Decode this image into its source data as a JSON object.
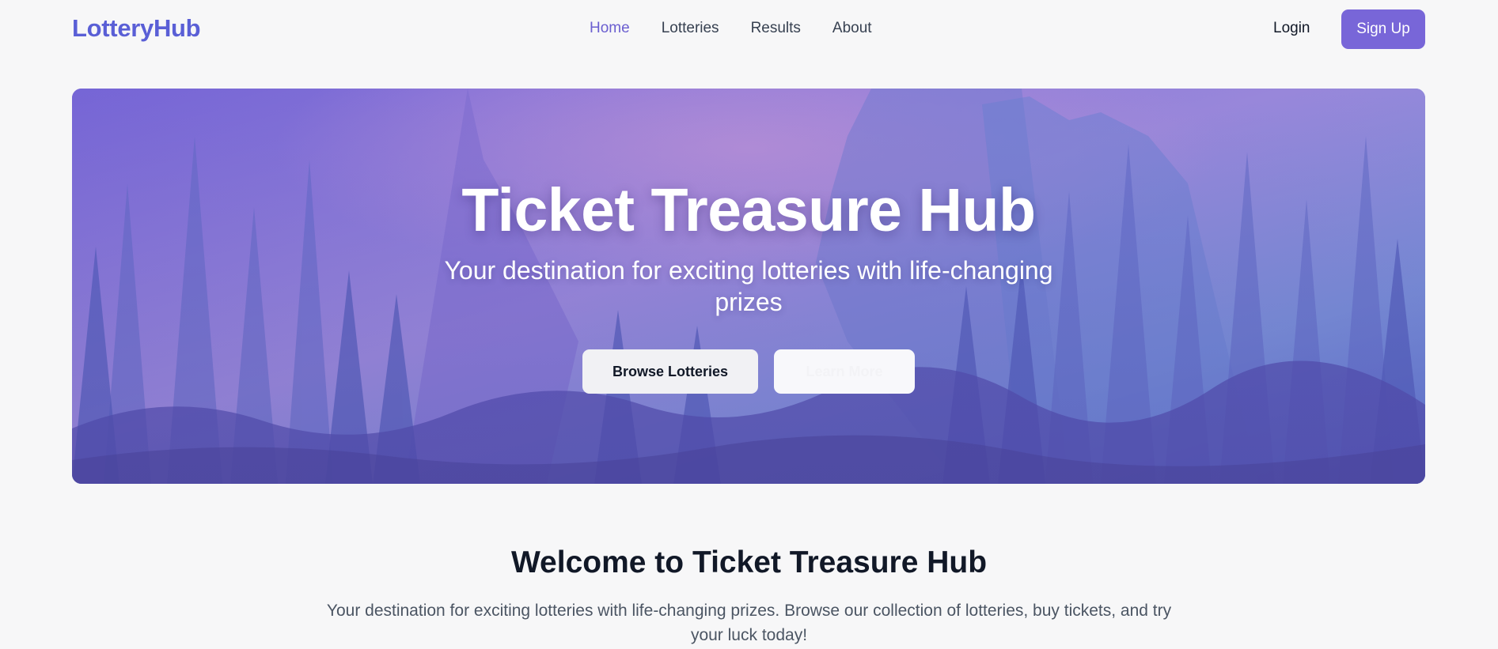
{
  "header": {
    "logo": "LotteryHub",
    "nav": [
      "Home",
      "Lotteries",
      "Results",
      "About"
    ],
    "active_nav": "Home",
    "login_label": "Login",
    "signup_label": "Sign Up"
  },
  "hero": {
    "title": "Ticket Treasure Hub",
    "subtitle": "Your destination for exciting lotteries with life-changing prizes",
    "browse_label": "Browse Lotteries",
    "learn_label": "Learn More"
  },
  "welcome": {
    "title": "Welcome to Ticket Treasure Hub",
    "text": "Your destination for exciting lotteries with life-changing prizes. Browse our collection of lotteries, buy tickets, and try your luck today!"
  },
  "colors": {
    "accent": "#7866d8",
    "logo": "#5a5fd6",
    "active_nav": "#6b5fd0",
    "background": "#f7f7f8"
  }
}
